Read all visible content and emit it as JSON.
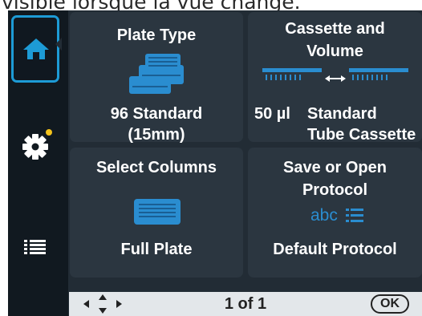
{
  "caption": {
    "text": "visible lorsque la vue change."
  },
  "sidebar": {
    "home_icon": "home-icon",
    "settings_icon": "gear-icon",
    "menu_icon": "list-icon",
    "notification_color": "#f3c21b",
    "accent_color": "#1d9bd6"
  },
  "tiles": {
    "plate": {
      "title": "Plate Type",
      "value_line1": "96 Standard",
      "value_line2": "(15mm)",
      "icon": "plate-stack-icon"
    },
    "cassette": {
      "title_line1": "Cassette and",
      "title_line2": "Volume",
      "volume": "50 µl",
      "value_line1": "Standard",
      "value_line2": "Tube Cassette",
      "icon": "cassette-volume-icon"
    },
    "columns": {
      "title": "Select Columns",
      "value": "Full Plate",
      "icon": "plate-icon"
    },
    "protocol": {
      "title_line1": "Save or Open",
      "title_line2": "Protocol",
      "icon_text": "abc",
      "value": "Default Protocol",
      "icon": "abc-list-icon"
    }
  },
  "footer": {
    "page_indicator": "1 of 1",
    "ok_label": "OK",
    "nav_icon": "direction-arrows-icon"
  }
}
